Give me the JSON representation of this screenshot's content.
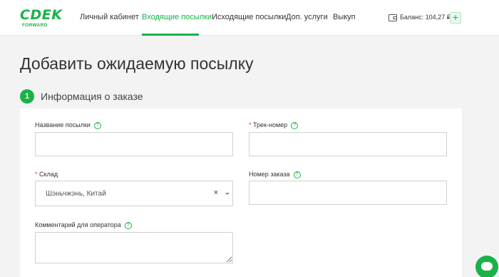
{
  "brand": {
    "logo": "CDEK",
    "sub": "FORWARD",
    "color": "#1ab248"
  },
  "nav": [
    {
      "label": "Личный кабинет",
      "active": false
    },
    {
      "label": "Входящие посылки",
      "active": true
    },
    {
      "label": "Исходящие посылки",
      "active": false
    },
    {
      "label": "Доп. услуги",
      "active": false
    },
    {
      "label": "Выкуп",
      "active": false
    }
  ],
  "header": {
    "balance": "Баланс: 104,27 ₽",
    "add_label": "+"
  },
  "page": {
    "title": "Добавить ожидаемую посылку"
  },
  "step": {
    "number": "1",
    "title": "Информация о заказе"
  },
  "form": {
    "parcel_name": {
      "label": "Название посылки",
      "value": "",
      "help": "?"
    },
    "track": {
      "required": "*",
      "label": "Трек-номер",
      "value": "",
      "help": "?"
    },
    "warehouse": {
      "required": "*",
      "label": "Склад",
      "value": "Шэньчжэнь, Китай",
      "clear": "×"
    },
    "order_number": {
      "label": "Номер заказа",
      "value": "",
      "help": "?"
    },
    "comment": {
      "label": "Комментарий для оператора",
      "value": "",
      "help": "?"
    }
  }
}
